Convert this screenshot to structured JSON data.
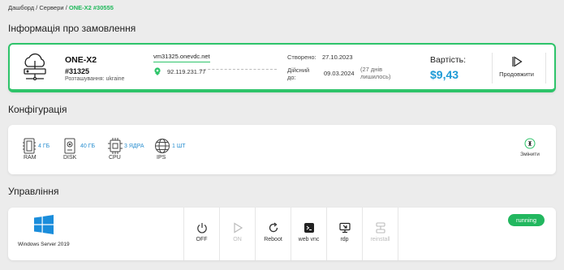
{
  "breadcrumb": {
    "dashboard": "Дашборд",
    "sep1": "/",
    "servers": "Сервери",
    "sep2": "/",
    "current": "ONE-X2 #30555"
  },
  "sections": {
    "order": "Інформація про замовлення",
    "config": "Конфігурація",
    "management": "Управління"
  },
  "order": {
    "name": "ONE-X2",
    "id": "#31325",
    "location": "Розташування: ukraine",
    "host": "vm31325.onevdc.net",
    "ip": "92.119.231.77",
    "created_label": "Створено:",
    "created_date": "27.10.2023",
    "active_label": "Дійсний до:",
    "active_date": "09.03.2024",
    "days_left": "(27 днів лишилось)",
    "price_label": "Вартість:",
    "price": "$9,43",
    "renew_label": "Продовжити"
  },
  "config": {
    "specs": [
      {
        "icon": "ram-icon",
        "value": "4 ГБ",
        "name": "RAM"
      },
      {
        "icon": "disk-icon",
        "value": "40 ГБ",
        "name": "DISK"
      },
      {
        "icon": "cpu-icon",
        "value": "3 ЯДРА",
        "name": "CPU"
      },
      {
        "icon": "globe-icon",
        "value": "1 ШТ",
        "name": "IPS"
      }
    ],
    "change_label": "Змінити"
  },
  "management": {
    "os": "Windows Server 2019",
    "status": "running",
    "actions": [
      {
        "icon": "power-icon",
        "label": "OFF",
        "enabled": true
      },
      {
        "icon": "play-icon",
        "label": "ON",
        "enabled": false
      },
      {
        "icon": "reboot-icon",
        "label": "Reboot",
        "enabled": true
      },
      {
        "icon": "terminal-icon",
        "label": "web vnc",
        "enabled": true
      },
      {
        "icon": "monitor-icon",
        "label": "rdp",
        "enabled": true
      },
      {
        "icon": "reinstall-icon",
        "label": "reinstall",
        "enabled": false
      }
    ]
  },
  "colors": {
    "accent": "#2ec46a",
    "price": "#1d9ad6",
    "link": "#2a8fd0",
    "status": "#22b75f"
  }
}
